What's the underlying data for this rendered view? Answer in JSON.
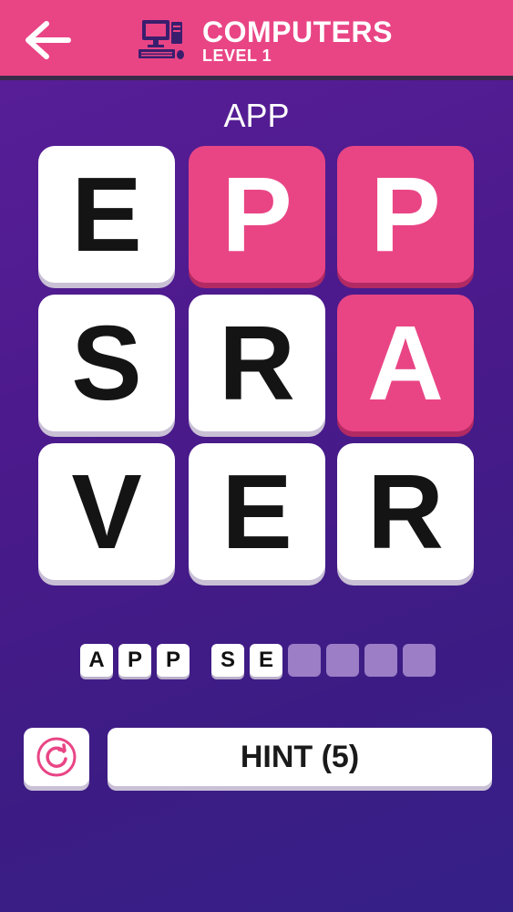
{
  "header": {
    "back_icon": "arrow-left-icon",
    "category_icon": "computer-icon",
    "title": "COMPUTERS",
    "level": "LEVEL 1",
    "bar_color": "#e94585"
  },
  "current_word": "APP",
  "grid": {
    "tiles": [
      {
        "letter": "E",
        "selected": false
      },
      {
        "letter": "P",
        "selected": true
      },
      {
        "letter": "P",
        "selected": true
      },
      {
        "letter": "S",
        "selected": false
      },
      {
        "letter": "R",
        "selected": false
      },
      {
        "letter": "A",
        "selected": true
      },
      {
        "letter": "V",
        "selected": false
      },
      {
        "letter": "E",
        "selected": false
      },
      {
        "letter": "R",
        "selected": false
      }
    ]
  },
  "answer": {
    "found_word": [
      "A",
      "P",
      "P"
    ],
    "second_word": [
      "S",
      "E",
      "",
      "",
      "",
      ""
    ]
  },
  "controls": {
    "reset_icon": "refresh-icon",
    "hint_label": "HINT (5)"
  },
  "colors": {
    "accent": "#e94585",
    "background": "#4c1a8c"
  }
}
